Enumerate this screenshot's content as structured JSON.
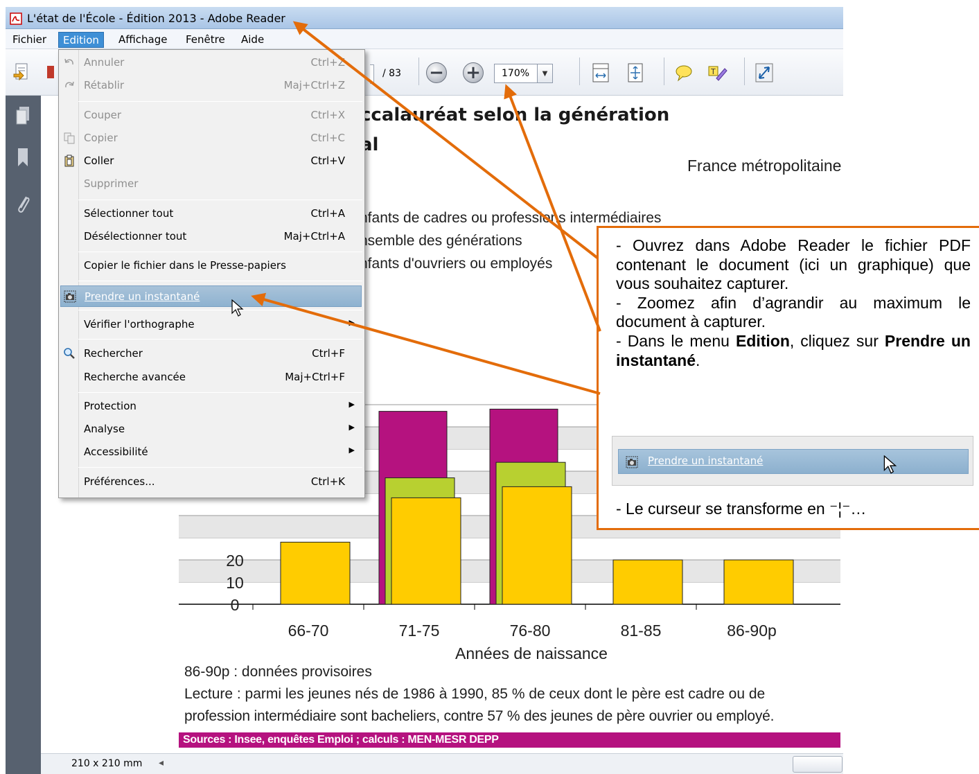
{
  "window": {
    "title": "L'état de l'École - Édition 2013 - Adobe Reader"
  },
  "menubar": {
    "items": [
      "Fichier",
      "Edition",
      "Affichage",
      "Fenêtre",
      "Aide"
    ]
  },
  "toolbar": {
    "page_total": "/ 83",
    "zoom": "170%"
  },
  "edit_menu": {
    "items": [
      {
        "label": "Annuler",
        "shortcut": "Ctrl+Z"
      },
      {
        "label": "Rétablir",
        "shortcut": "Maj+Ctrl+Z"
      },
      {
        "label": "Couper",
        "shortcut": "Ctrl+X"
      },
      {
        "label": "Copier",
        "shortcut": "Ctrl+C"
      },
      {
        "label": "Coller",
        "shortcut": "Ctrl+V"
      },
      {
        "label": "Supprimer",
        "shortcut": ""
      },
      {
        "label": "Sélectionner tout",
        "shortcut": "Ctrl+A"
      },
      {
        "label": "Désélectionner tout",
        "shortcut": "Maj+Ctrl+A"
      },
      {
        "label": "Copier le fichier dans le Presse-papiers",
        "shortcut": ""
      },
      {
        "label": "Prendre un instantané",
        "shortcut": ""
      },
      {
        "label": "Vérifier l'orthographe",
        "shortcut": ""
      },
      {
        "label": "Rechercher",
        "shortcut": "Ctrl+F"
      },
      {
        "label": "Recherche avancée",
        "shortcut": "Maj+Ctrl+F"
      },
      {
        "label": "Protection",
        "shortcut": ""
      },
      {
        "label": "Analyse",
        "shortcut": ""
      },
      {
        "label": "Accessibilité",
        "shortcut": ""
      },
      {
        "label": "Préférences...",
        "shortcut": "Ctrl+K"
      }
    ]
  },
  "document": {
    "title_line1": "ccalauréat selon la génération",
    "title_line2": "al",
    "region": "France métropolitaine",
    "legend": [
      "nfants de cadres ou professions intermédiaires",
      "nsemble des générations",
      "nfants d'ouvriers ou employés"
    ],
    "note_provisional": "86-90p : données provisoires",
    "reading_line1": "Lecture : parmi les jeunes nés de 1986 à 1990, 85 % de ceux dont le père est cadre ou de",
    "reading_line2": "profession intermédiaire sont bacheliers, contre 57 % des jeunes de père ouvrier ou employé.",
    "sources": "Sources : Insee, enquêtes Emploi ; calculs : MEN-MESR DEPP"
  },
  "statusbar": {
    "page_size": "210 x 210 mm"
  },
  "callout": {
    "p1": "- Ouvrez dans Adobe Reader le fichier PDF contenant le document (ici un graphique) que vous souhaitez capturer.",
    "p2": "- Zoomez afin d’agrandir au maximum le document à capturer.",
    "p3_a": "- Dans le menu ",
    "p3_b": "Edition",
    "p3_c": ", cliquez sur ",
    "p3_d": "Prendre un instantané",
    "p3_e": ".",
    "snap_label": "Prendre un instantané",
    "last": "- Le curseur se transforme en ⁻¦⁻…"
  },
  "chart_data": {
    "type": "bar",
    "xlabel": "Années de naissance",
    "ylabel": "",
    "categories": [
      "66-70",
      "71-75",
      "76-80",
      "81-85",
      "86-90p"
    ],
    "y_ticks": [
      "0",
      "10",
      "20"
    ],
    "colors": {
      "cadres": "#b5127f",
      "ensemble": "#b8d030",
      "ouvriers": "#ffcc00"
    },
    "bars_visible": [
      {
        "category": "66-70",
        "ouvriers": 28
      },
      {
        "category": "71-75",
        "cadres": 87,
        "ensemble": 57,
        "ouvriers": 48
      },
      {
        "category": "76-80",
        "cadres": 88,
        "ensemble": 64,
        "ouvriers": 53
      },
      {
        "category": "81-85",
        "ouvriers": 20
      },
      {
        "category": "86-90p",
        "ouvriers": 20
      }
    ],
    "ylim": [
      0,
      90
    ]
  }
}
